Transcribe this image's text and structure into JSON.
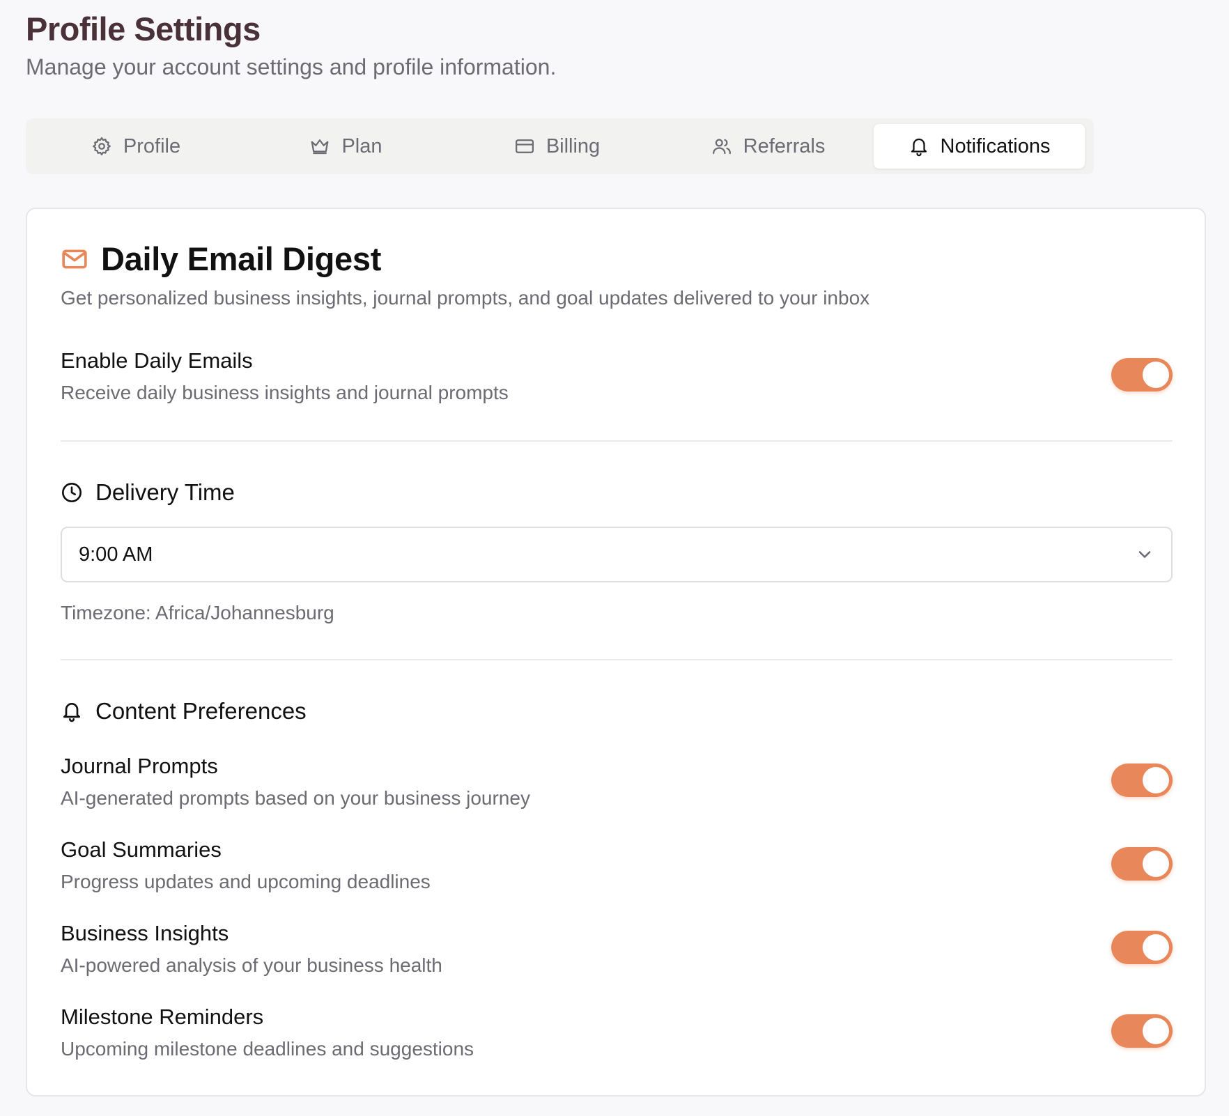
{
  "header": {
    "title": "Profile Settings",
    "subtitle": "Manage your account settings and profile information."
  },
  "tabs": [
    {
      "label": "Profile",
      "icon": "gear-icon"
    },
    {
      "label": "Plan",
      "icon": "crown-icon"
    },
    {
      "label": "Billing",
      "icon": "credit-card-icon"
    },
    {
      "label": "Referrals",
      "icon": "users-icon"
    },
    {
      "label": "Notifications",
      "icon": "bell-icon",
      "active": true
    }
  ],
  "digest": {
    "title": "Daily Email Digest",
    "icon": "mail-icon",
    "description": "Get personalized business insights, journal prompts, and goal updates delivered to your inbox",
    "enable": {
      "label": "Enable Daily Emails",
      "sub": "Receive daily business insights and journal prompts",
      "on": true
    },
    "delivery": {
      "title": "Delivery Time",
      "icon": "clock-icon",
      "selected": "9:00 AM",
      "timezone": "Timezone: Africa/Johannesburg"
    },
    "content": {
      "title": "Content Preferences",
      "icon": "bell-icon",
      "items": [
        {
          "label": "Journal Prompts",
          "sub": "AI-generated prompts based on your business journey",
          "on": true
        },
        {
          "label": "Goal Summaries",
          "sub": "Progress updates and upcoming deadlines",
          "on": true
        },
        {
          "label": "Business Insights",
          "sub": "AI-powered analysis of your business health",
          "on": true
        },
        {
          "label": "Milestone Reminders",
          "sub": "Upcoming milestone deadlines and suggestions",
          "on": true
        }
      ]
    }
  },
  "colors": {
    "accent": "#e8875a",
    "title": "#4a3138",
    "muted": "#6b6b73"
  }
}
